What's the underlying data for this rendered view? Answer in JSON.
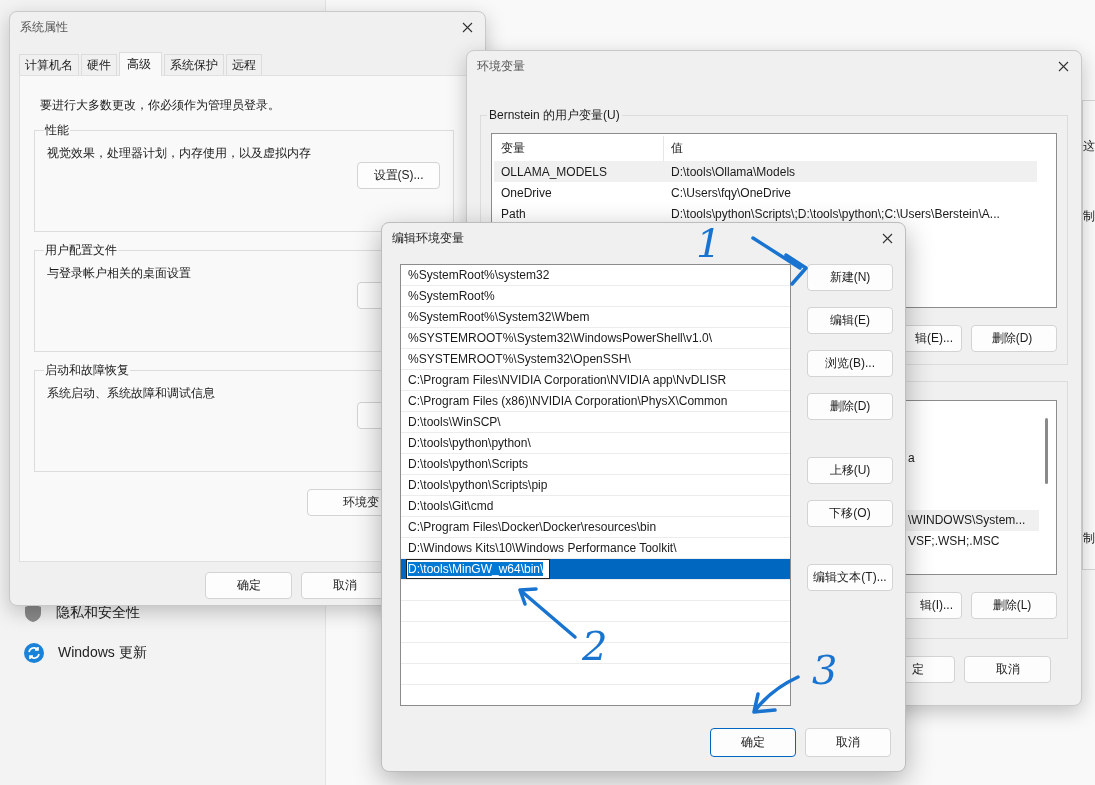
{
  "settings_window": {
    "nav_items": [
      {
        "label": "隐私和安全性",
        "kind": "privacy"
      },
      {
        "label": "Windows 更新",
        "kind": "update"
      }
    ]
  },
  "edge_window": {
    "texts": [
      "这",
      "制",
      "制"
    ]
  },
  "system_properties": {
    "title": "系统属性",
    "tabs": [
      {
        "label": "计算机名",
        "selected": false
      },
      {
        "label": "硬件",
        "selected": false
      },
      {
        "label": "高级",
        "selected": true
      },
      {
        "label": "系统保护",
        "selected": false
      },
      {
        "label": "远程",
        "selected": false
      }
    ],
    "notice": "要进行大多数更改，你必须作为管理员登录。",
    "groups": [
      {
        "title": "性能",
        "description": "视觉效果，处理器计划，内存使用，以及虚拟内存",
        "button": "设置(S)..."
      },
      {
        "title": "用户配置文件",
        "description": "与登录帐户相关的桌面设置"
      },
      {
        "title": "启动和故障恢复",
        "description": "系统启动、系统故障和调试信息"
      }
    ],
    "env_button": "环境变",
    "buttons": [
      "确定",
      "取消"
    ]
  },
  "environment_variables": {
    "title": "环境变量",
    "user_group": "Bernstein 的用户变量(U)",
    "columns": [
      "变量",
      "值"
    ],
    "rows": [
      {
        "name": "OLLAMA_MODELS",
        "value": "D:\\tools\\Ollama\\Models",
        "selected": true
      },
      {
        "name": "OneDrive",
        "value": "C:\\Users\\fqy\\OneDrive",
        "selected": false
      },
      {
        "name": "Path",
        "value": "D:\\tools\\python\\Scripts\\;D:\\tools\\python\\;C:\\Users\\Berstein\\A...",
        "selected": false
      }
    ],
    "user_buttons": [
      "辑(E)...",
      "删除(D)"
    ],
    "system_rows": [
      {
        "text": "a",
        "selected": false
      },
      {
        "text": "\\WINDOWS\\System...",
        "selected": true
      },
      {
        "text": "VSF;.WSH;.MSC",
        "selected": false
      }
    ],
    "system_buttons": [
      "辑(I)...",
      "删除(L)"
    ],
    "buttons": [
      "定",
      "取消"
    ]
  },
  "edit_dialog": {
    "title": "编辑环境变量",
    "entries": [
      {
        "text": "%SystemRoot%\\system32",
        "editing": false
      },
      {
        "text": "%SystemRoot%",
        "editing": false
      },
      {
        "text": "%SystemRoot%\\System32\\Wbem",
        "editing": false
      },
      {
        "text": "%SYSTEMROOT%\\System32\\WindowsPowerShell\\v1.0\\",
        "editing": false
      },
      {
        "text": "%SYSTEMROOT%\\System32\\OpenSSH\\",
        "editing": false
      },
      {
        "text": "C:\\Program Files\\NVIDIA Corporation\\NVIDIA app\\NvDLISR",
        "editing": false
      },
      {
        "text": "C:\\Program Files (x86)\\NVIDIA Corporation\\PhysX\\Common",
        "editing": false
      },
      {
        "text": "D:\\tools\\WinSCP\\",
        "editing": false
      },
      {
        "text": "D:\\tools\\python\\python\\",
        "editing": false
      },
      {
        "text": "D:\\tools\\python\\Scripts",
        "editing": false
      },
      {
        "text": "D:\\tools\\python\\Scripts\\pip",
        "editing": false
      },
      {
        "text": "D:\\tools\\Git\\cmd",
        "editing": false
      },
      {
        "text": "C:\\Program Files\\Docker\\Docker\\resources\\bin",
        "editing": false
      },
      {
        "text": "D:\\Windows Kits\\10\\Windows Performance Toolkit\\",
        "editing": false
      },
      {
        "text": "D:\\tools\\MinGW_w64\\bin\\",
        "editing": true
      }
    ],
    "buttons": [
      "新建(N)",
      "编辑(E)",
      "浏览(B)...",
      "删除(D)",
      "上移(U)",
      "下移(O)",
      "编辑文本(T)..."
    ],
    "footer_buttons": [
      {
        "label": "确定",
        "default": true
      },
      {
        "label": "取消",
        "default": false
      }
    ]
  },
  "annotations": [
    "1",
    "2",
    "3"
  ]
}
